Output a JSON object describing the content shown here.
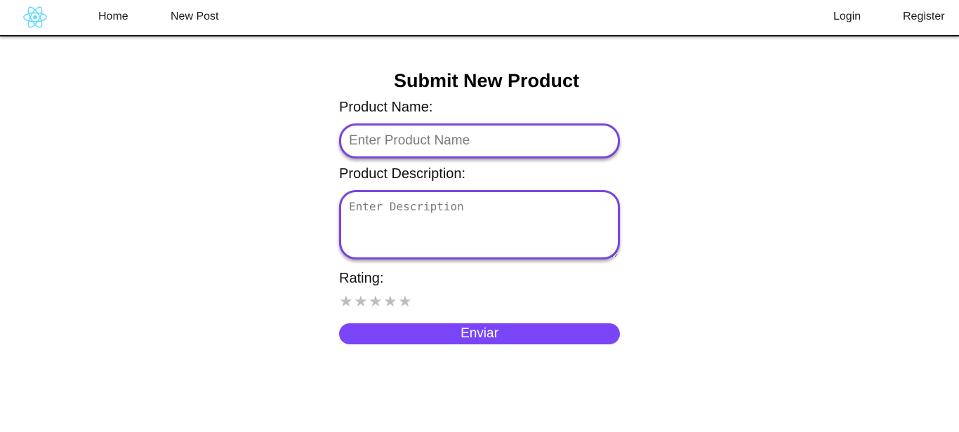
{
  "navbar": {
    "logo_icon": "react-atom-icon",
    "links": {
      "home": "Home",
      "new_post": "New Post",
      "login": "Login",
      "register": "Register"
    }
  },
  "form": {
    "title": "Submit New Product",
    "product_name": {
      "label": "Product Name:",
      "placeholder": "Enter Product Name",
      "value": ""
    },
    "product_description": {
      "label": "Product Description:",
      "placeholder": "Enter Description",
      "value": ""
    },
    "rating": {
      "label": "Rating:",
      "max": 5,
      "value": 0,
      "star_glyph": "★",
      "empty_color": "#bdbdbd"
    },
    "submit_label": "Enviar"
  },
  "colors": {
    "accent": "#7a45f7",
    "input_border": "#7a45e0",
    "logo": "#61dafb"
  }
}
